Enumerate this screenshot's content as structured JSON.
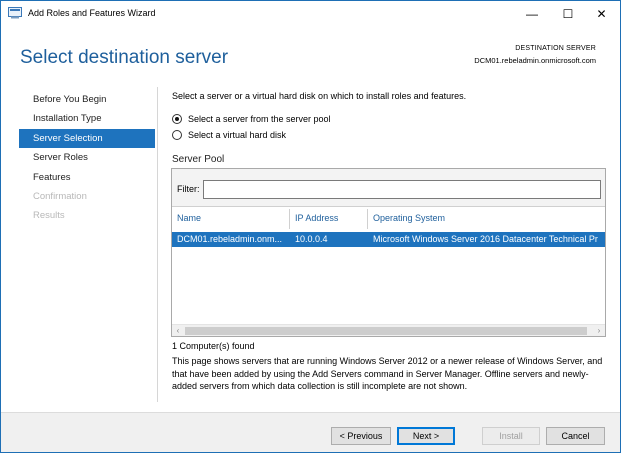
{
  "window": {
    "title": "Add Roles and Features Wizard",
    "controls": {
      "minimize": "—",
      "maximize": "☐",
      "close": "✕"
    }
  },
  "header": {
    "title": "Select destination server",
    "destination_label": "DESTINATION SERVER",
    "destination_value": "DCM01.rebeladmin.onmicrosoft.com"
  },
  "nav": {
    "items": [
      {
        "label": "Before You Begin",
        "state": "normal"
      },
      {
        "label": "Installation Type",
        "state": "normal"
      },
      {
        "label": "Server Selection",
        "state": "active"
      },
      {
        "label": "Server Roles",
        "state": "normal"
      },
      {
        "label": "Features",
        "state": "normal"
      },
      {
        "label": "Confirmation",
        "state": "disabled"
      },
      {
        "label": "Results",
        "state": "disabled"
      }
    ]
  },
  "content": {
    "intro": "Select a server or a virtual hard disk on which to install roles and features.",
    "options": [
      {
        "label": "Select a server from the server pool",
        "checked": true
      },
      {
        "label": "Select a virtual hard disk",
        "checked": false
      }
    ],
    "pool_title": "Server Pool",
    "filter_label": "Filter:",
    "filter_value": "",
    "columns": [
      "Name",
      "IP Address",
      "Operating System"
    ],
    "rows": [
      {
        "name": "DCM01.rebeladmin.onm...",
        "ip": "10.0.0.4",
        "os": "Microsoft Windows Server 2016 Datacenter Technical Pr"
      }
    ],
    "count": "1 Computer(s) found",
    "description": "This page shows servers that are running Windows Server 2012 or a newer release of Windows Server, and that have been added by using the Add Servers command in Server Manager. Offline servers and newly-added servers from which data collection is still incomplete are not shown."
  },
  "footer": {
    "previous": "< Previous",
    "next": "Next >",
    "install": "Install",
    "cancel": "Cancel"
  },
  "colors": {
    "accent": "#1e73be",
    "title_blue": "#1e5f9c"
  }
}
